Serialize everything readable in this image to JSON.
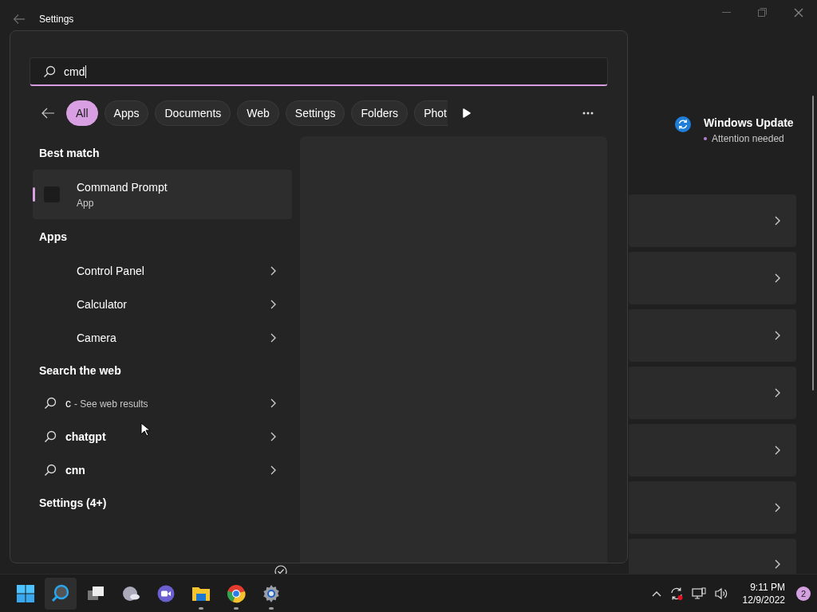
{
  "window": {
    "title": "Settings"
  },
  "update": {
    "title": "Windows Update",
    "status": "Attention needed"
  },
  "search": {
    "value": "cmd"
  },
  "filters": [
    {
      "label": "All",
      "selected": true
    },
    {
      "label": "Apps",
      "selected": false
    },
    {
      "label": "Documents",
      "selected": false
    },
    {
      "label": "Web",
      "selected": false
    },
    {
      "label": "Settings",
      "selected": false
    },
    {
      "label": "Folders",
      "selected": false
    },
    {
      "label": "Phot",
      "selected": false
    }
  ],
  "best_match": {
    "heading": "Best match",
    "name": "Command Prompt",
    "type": "App",
    "selected": true
  },
  "apps": {
    "heading": "Apps",
    "items": [
      "Control Panel",
      "Calculator",
      "Camera"
    ]
  },
  "web": {
    "heading": "Search the web",
    "items": [
      {
        "text": "c",
        "hint": "- See web results"
      },
      {
        "text": "chatgpt"
      },
      {
        "text": "cnn"
      }
    ]
  },
  "settings_results": {
    "heading": "Settings (4+)"
  },
  "taskbar": {
    "apps": [
      {
        "kind": "start",
        "selected": false,
        "running": false
      },
      {
        "kind": "search",
        "selected": true,
        "running": false
      },
      {
        "kind": "taskview",
        "selected": false,
        "running": false
      },
      {
        "kind": "weather",
        "selected": false,
        "running": false
      },
      {
        "kind": "chat",
        "selected": false,
        "running": false
      },
      {
        "kind": "explorer",
        "selected": false,
        "running": true
      },
      {
        "kind": "chrome",
        "selected": false,
        "running": true
      },
      {
        "kind": "settings",
        "selected": false,
        "running": true
      }
    ],
    "time": "9:11 PM",
    "date": "12/9/2022",
    "notifications": "2"
  }
}
